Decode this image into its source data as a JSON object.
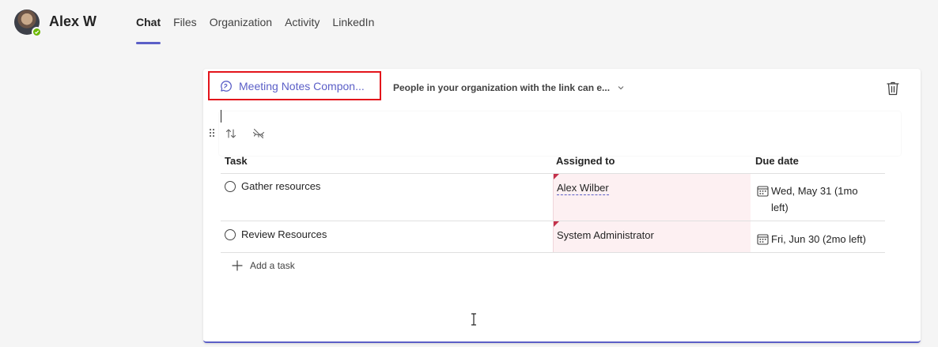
{
  "header": {
    "user_name": "Alex W",
    "tabs": [
      {
        "label": "Chat",
        "active": true
      },
      {
        "label": "Files",
        "active": false
      },
      {
        "label": "Organization",
        "active": false
      },
      {
        "label": "Activity",
        "active": false
      },
      {
        "label": "LinkedIn",
        "active": false
      }
    ]
  },
  "card": {
    "component_name": "Meeting Notes Compon...",
    "permission_text": "People in your organization with the link can e...",
    "table": {
      "headers": {
        "task": "Task",
        "assigned": "Assigned to",
        "due": "Due date"
      },
      "rows": [
        {
          "task": "Gather resources",
          "assigned": "Alex Wilber",
          "due": "Wed, May 31 (1mo left)"
        },
        {
          "task": "Review Resources",
          "assigned": "System Administrator",
          "due": "Fri, Jun 30 (2mo left)"
        }
      ],
      "add_task_label": "Add a task"
    }
  },
  "colors": {
    "accent": "#5b5fc7",
    "highlight_border": "#e3141b",
    "assigned_bg": "#fdf0f2",
    "presence": "#6bb700"
  },
  "icons": {
    "chat_bubble": "chat-bubble-icon",
    "chevron": "chevron-down-icon",
    "trash": "trash-icon",
    "sort": "sort-icon",
    "hide": "eye-off-icon",
    "calendar": "calendar-icon",
    "add": "plus-icon",
    "drag": "drag-handle-icon"
  }
}
